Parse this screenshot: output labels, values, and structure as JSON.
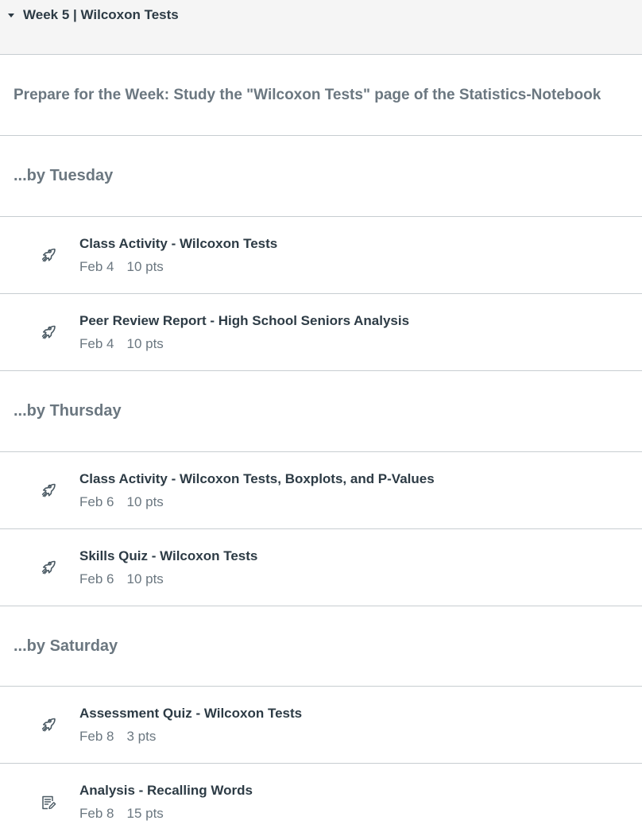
{
  "module": {
    "title": "Week 5 | Wilcoxon Tests",
    "prepare_text": "Prepare for the Week: Study the \"Wilcoxon Tests\" page of the Statistics-Notebook"
  },
  "sections": [
    {
      "heading": "...by Tuesday",
      "items": [
        {
          "title": "Class Activity - Wilcoxon Tests",
          "date": "Feb 4",
          "points": "10 pts",
          "icon": "rocket-icon"
        },
        {
          "title": "Peer Review Report - High School Seniors Analysis",
          "date": "Feb 4",
          "points": "10 pts",
          "icon": "rocket-icon"
        }
      ]
    },
    {
      "heading": "...by Thursday",
      "items": [
        {
          "title": "Class Activity - Wilcoxon Tests, Boxplots, and P-Values",
          "date": "Feb 6",
          "points": "10 pts",
          "icon": "rocket-icon"
        },
        {
          "title": "Skills Quiz - Wilcoxon Tests",
          "date": "Feb 6",
          "points": "10 pts",
          "icon": "rocket-icon"
        }
      ]
    },
    {
      "heading": "...by Saturday",
      "items": [
        {
          "title": "Assessment Quiz - Wilcoxon Tests",
          "date": "Feb 8",
          "points": "3 pts",
          "icon": "rocket-icon"
        },
        {
          "title": "Analysis - Recalling Words",
          "date": "Feb 8",
          "points": "15 pts",
          "icon": "assignment-edit-icon"
        }
      ]
    }
  ]
}
